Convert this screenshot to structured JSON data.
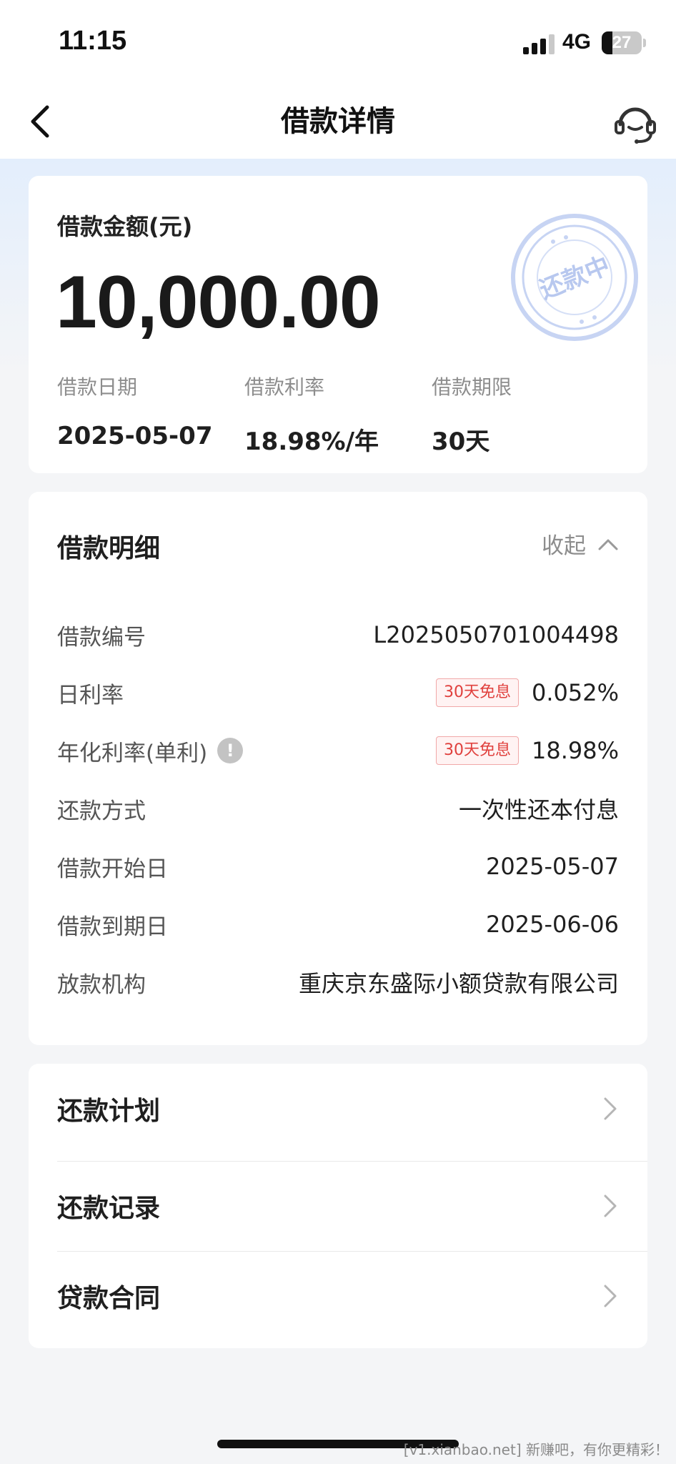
{
  "status_bar": {
    "time": "11:15",
    "network": "4G",
    "battery": "27",
    "battery_level": 0.27
  },
  "nav": {
    "title": "借款详情",
    "back_icon": "chevron-left-icon",
    "support_icon": "headset-icon"
  },
  "summary": {
    "amount_label": "借款金额(元)",
    "amount": "10,000.00",
    "stamp_text": "还款中",
    "items": [
      {
        "label": "借款日期",
        "value": "2025-05-07"
      },
      {
        "label": "借款利率",
        "value": "18.98%/年"
      },
      {
        "label": "借款期限",
        "value": "30天"
      }
    ]
  },
  "details": {
    "title": "借款明细",
    "collapse_label": "收起",
    "rows": [
      {
        "label": "借款编号",
        "value": "L2025050701004498"
      },
      {
        "label": "日利率",
        "tag": "30天免息",
        "value": "0.052%"
      },
      {
        "label": "年化利率(单利)",
        "info_icon": "!",
        "tag": "30天免息",
        "value": "18.98%"
      },
      {
        "label": "还款方式",
        "value": "一次性还本付息"
      },
      {
        "label": "借款开始日",
        "value": "2025-05-07"
      },
      {
        "label": "借款到期日",
        "value": "2025-06-06"
      },
      {
        "label": "放款机构",
        "value": "重庆京东盛际小额贷款有限公司"
      }
    ]
  },
  "links": [
    {
      "label": "还款计划"
    },
    {
      "label": "还款记录"
    },
    {
      "label": "贷款合同"
    }
  ],
  "watermark": "[v1.xianbao.net] 新赚吧，有你更精彩！",
  "colors": {
    "tag_red": "#e0413e",
    "stamp_blue": "#9db4ec",
    "page_bg": "#f4f5f7"
  }
}
